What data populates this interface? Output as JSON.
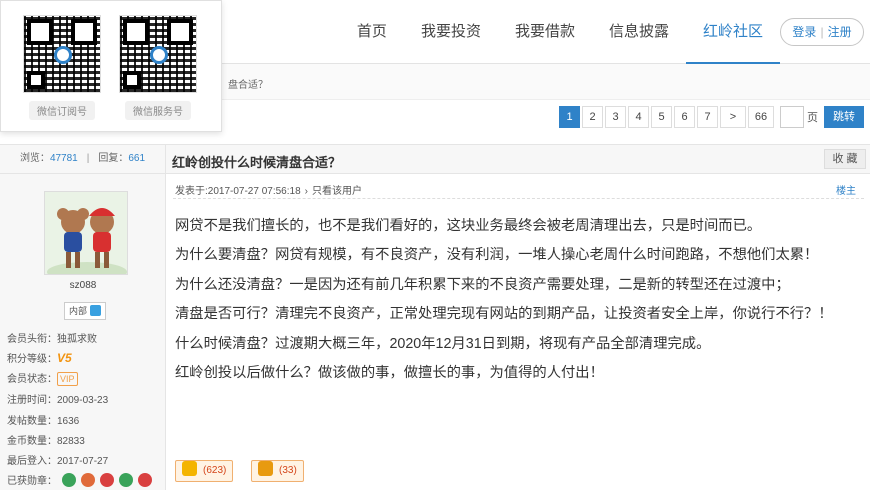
{
  "nav": {
    "items": [
      {
        "label": "首页"
      },
      {
        "label": "我要投资"
      },
      {
        "label": "我要借款"
      },
      {
        "label": "信息披露"
      },
      {
        "label": "红岭社区"
      }
    ],
    "auth": {
      "login": "登录",
      "register": "注册"
    }
  },
  "qr_popup": {
    "subscription": "微信订阅号",
    "service": "微信服务号"
  },
  "breadcrumb": {
    "tail": "盘合适？"
  },
  "pager": {
    "pages": [
      "1",
      "2",
      "3",
      "4",
      "5",
      "6",
      "7"
    ],
    "next": ">",
    "last": "66",
    "unit": "页",
    "go": "跳转",
    "current": "1"
  },
  "thread": {
    "views_label": "浏览：",
    "views": "47781",
    "replies_label": "回复：",
    "replies": "661",
    "separator": "|",
    "title": "红岭创投什么时候清盘合适？",
    "favorite": "收 藏"
  },
  "user": {
    "name": "sz088",
    "role": "内部",
    "rows": [
      {
        "key": "会员头衔：",
        "value": "独孤求败"
      },
      {
        "key": "积分等级：",
        "value": "V5"
      },
      {
        "key": "会员状态：",
        "value": "VIP"
      },
      {
        "key": "注册时间：",
        "value": "2009-03-23"
      },
      {
        "key": "发帖数量：",
        "value": "1636"
      },
      {
        "key": "金币数量：",
        "value": "82833"
      },
      {
        "key": "最后登入：",
        "value": "2017-07-27"
      },
      {
        "key": "已获勋章：",
        "value": ""
      }
    ],
    "medal_colors": [
      "#3aa35a",
      "#e06a3a",
      "#d94040",
      "#3aa35a",
      "#d94040"
    ]
  },
  "post": {
    "posted_label": "发表于:",
    "posted_at": "2017-07-27 07:56:18",
    "only_author": "只看该用户",
    "floor": "楼主",
    "paragraphs": [
      "网贷不是我们擅长的，也不是我们看好的，这块业务最终会被老周清理出去，只是时间而已。",
      "为什么要清盘？网贷有规模，有不良资产，没有利润，一堆人操心老周什么时间跑路，不想他们太累！",
      "为什么还没清盘？一是因为还有前几年积累下来的不良资产需要处理，二是新的转型还在过渡中；",
      "清盘是否可行？清理完不良资产，正常处理完现有网站的到期产品，让投资者安全上岸，你说行不行？！",
      "什么时候清盘？过渡期大概三年，2020年12月31日到期，将现有产品全部清理完成。",
      "红岭创投以后做什么？做该做的事，做擅长的事，为值得的人付出！"
    ],
    "likes": "(623)",
    "dislikes": "(33)"
  },
  "colors": {
    "accent": "#2f82c8",
    "vote": "#d4451a"
  }
}
